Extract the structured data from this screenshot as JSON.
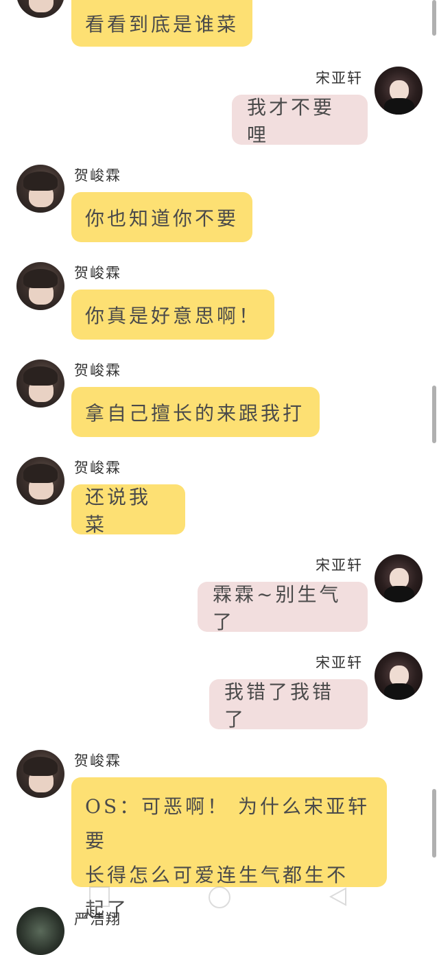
{
  "messages": [
    {
      "side": "left",
      "sender": "",
      "text": "看看到底是谁菜"
    },
    {
      "side": "right",
      "sender": "宋亚轩",
      "text": "我才不要哩"
    },
    {
      "side": "left",
      "sender": "贺峻霖",
      "text": "你也知道你不要"
    },
    {
      "side": "left",
      "sender": "贺峻霖",
      "text": "你真是好意思啊！"
    },
    {
      "side": "left",
      "sender": "贺峻霖",
      "text": "拿自己擅长的来跟我打"
    },
    {
      "side": "left",
      "sender": "贺峻霖",
      "text": "还说我菜"
    },
    {
      "side": "right",
      "sender": "宋亚轩",
      "text": "霖霖~别生气了"
    },
    {
      "side": "right",
      "sender": "宋亚轩",
      "text": "我错了我错了"
    },
    {
      "side": "left",
      "sender": "贺峻霖",
      "text": "OS：可恶啊！ 为什么宋亚轩要\n长得怎么可爱连生气都生不\n起了"
    },
    {
      "side": "left",
      "sender": "严浩翔",
      "text": ""
    }
  ],
  "colors": {
    "left_bubble": "#fde073",
    "right_bubble": "#f2dede"
  },
  "icons": {
    "nav_recent": "square-icon",
    "nav_home": "circle-icon",
    "nav_back": "triangle-back-icon"
  }
}
